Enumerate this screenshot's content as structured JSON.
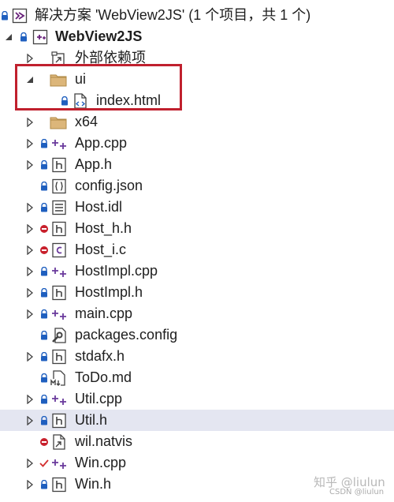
{
  "solution": {
    "label": "解决方案 'WebView2JS' (1 个项目，共 1 个)"
  },
  "project": {
    "label": "WebView2JS"
  },
  "items": [
    {
      "label": "外部依赖项",
      "icon": "external-deps-icon"
    },
    {
      "label": "ui",
      "icon": "folder-icon"
    },
    {
      "label": "index.html",
      "icon": "html-file-icon"
    },
    {
      "label": "x64",
      "icon": "folder-icon"
    },
    {
      "label": "App.cpp",
      "icon": "cpp-file-icon"
    },
    {
      "label": "App.h",
      "icon": "header-file-icon"
    },
    {
      "label": "config.json",
      "icon": "json-file-icon"
    },
    {
      "label": "Host.idl",
      "icon": "idl-file-icon"
    },
    {
      "label": "Host_h.h",
      "icon": "header-file-icon"
    },
    {
      "label": "Host_i.c",
      "icon": "c-file-icon"
    },
    {
      "label": "HostImpl.cpp",
      "icon": "cpp-file-icon"
    },
    {
      "label": "HostImpl.h",
      "icon": "header-file-icon"
    },
    {
      "label": "main.cpp",
      "icon": "cpp-file-icon"
    },
    {
      "label": "packages.config",
      "icon": "config-file-icon"
    },
    {
      "label": "stdafx.h",
      "icon": "header-file-icon"
    },
    {
      "label": "ToDo.md",
      "icon": "markdown-file-icon"
    },
    {
      "label": "Util.cpp",
      "icon": "cpp-file-icon"
    },
    {
      "label": "Util.h",
      "icon": "header-file-icon"
    },
    {
      "label": "wil.natvis",
      "icon": "natvis-file-icon"
    },
    {
      "label": "Win.cpp",
      "icon": "cpp-file-icon"
    },
    {
      "label": "Win.h",
      "icon": "header-file-icon"
    }
  ],
  "watermark": {
    "main": "知乎 @liulun",
    "sub": "CSDN @liulun"
  },
  "colors": {
    "selected_row": "#e4e6f1",
    "highlight_box": "#c0202e",
    "cpp_plus": "#6a3a9c",
    "lock_blue": "#1f5fbf",
    "excluded_red": "#c8202c",
    "pending_red": "#d32f2f"
  }
}
